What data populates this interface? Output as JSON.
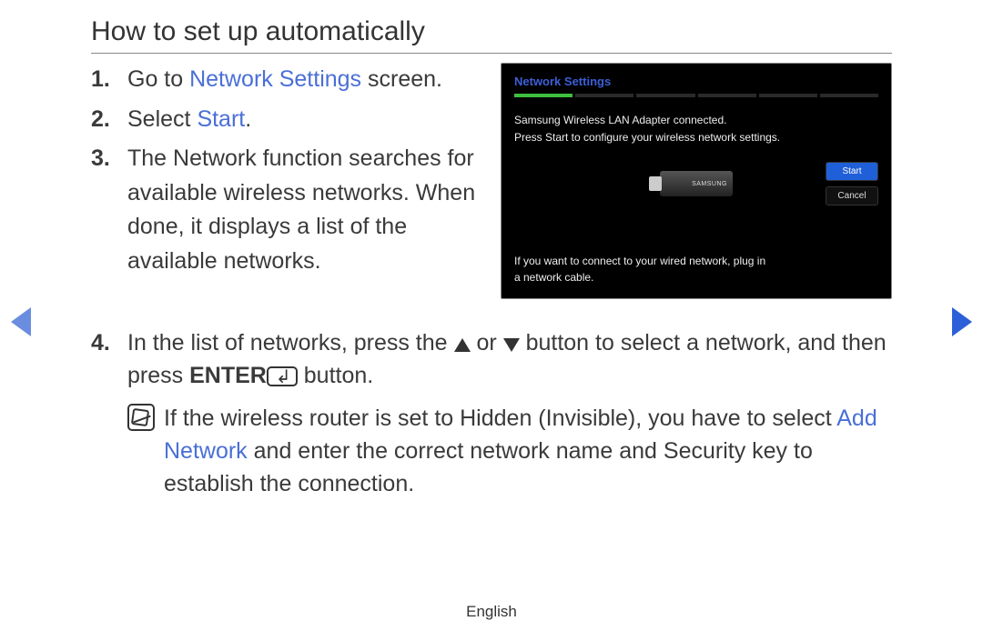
{
  "title": "How to set up automatically",
  "steps": {
    "s1": {
      "num": "1.",
      "pre": "Go to ",
      "link": "Network Settings",
      "post": " screen."
    },
    "s2": {
      "num": "2.",
      "pre": "Select ",
      "link": "Start",
      "post": "."
    },
    "s3": {
      "num": "3.",
      "text": "The Network function searches for available wireless networks. When done, it displays a list of the available networks."
    },
    "s4": {
      "num": "4.",
      "seg1": "In the list of networks, press the ",
      "or": " or ",
      "seg2": " button to select a network, and then press ",
      "enter": "ENTER",
      "seg3": " button."
    }
  },
  "note": {
    "seg1": "If the wireless router is set to Hidden (Invisible), you have to select ",
    "link": "Add Network",
    "seg2": " and enter the correct network name and Security key to establish the connection."
  },
  "panel": {
    "title": "Network Settings",
    "line1": "Samsung Wireless LAN Adapter connected.",
    "line2": "Press Start to configure your wireless network settings.",
    "adapter": "SAMSUNG",
    "start": "Start",
    "cancel": "Cancel",
    "foot": "If you want to connect to your wired network, plug in a network cable."
  },
  "footer": "English"
}
